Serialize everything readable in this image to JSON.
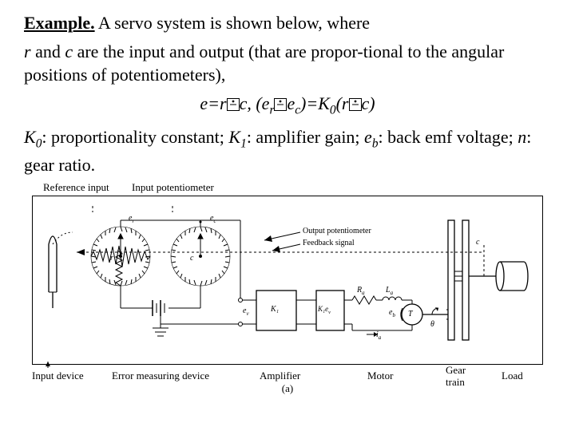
{
  "heading": {
    "lead": "Example.",
    "rest": " A servo system is shown below, where"
  },
  "sentence": {
    "r": "r",
    "and1": " and ",
    "c": "c",
    "rest": " are the input and output (that are propor-tional to the angular positions of potentiometers),"
  },
  "equation": {
    "e": "e=r",
    "c1": "c, (e",
    "sub_r": "r",
    "mid": "e",
    "sub_c": "c",
    "close": ")=K",
    "sub_0": "0",
    "open_r": "(r",
    "final_c": "c)"
  },
  "defs": {
    "K0a": "K",
    "K0sub": "0",
    "K0txt": ": proportionality constant; ",
    "K1a": "K",
    "K1sub": "1",
    "K1txt": ": amplifier gain; ",
    "eb": "e",
    "eb_sub": "b",
    "ebtxt": ": back emf voltage; ",
    "n": "n",
    "ntxt": ": gear ratio."
  },
  "diagram": {
    "top": {
      "ref_input": "Reference input",
      "input_pot": "Input potentiometer",
      "out_pot": "Output potentiometer",
      "feedback": "Feedback signal"
    },
    "symbols": {
      "er": "e_r",
      "ec": "e_c",
      "r": "r",
      "c": "c",
      "ev": "e_v",
      "K1": "K₁",
      "K1ev": "K₁e_v",
      "Ra": "R_a",
      "La": "L_a",
      "eb": "e_b",
      "ia": "i_a",
      "T": "T",
      "theta": "θ"
    },
    "bottom": {
      "input_dev": "Input device",
      "error_dev": "Error measuring device",
      "amplifier": "Amplifier",
      "motor": "Motor",
      "gear": "Gear\ntrain",
      "load": "Load"
    },
    "caption": "(a)"
  }
}
